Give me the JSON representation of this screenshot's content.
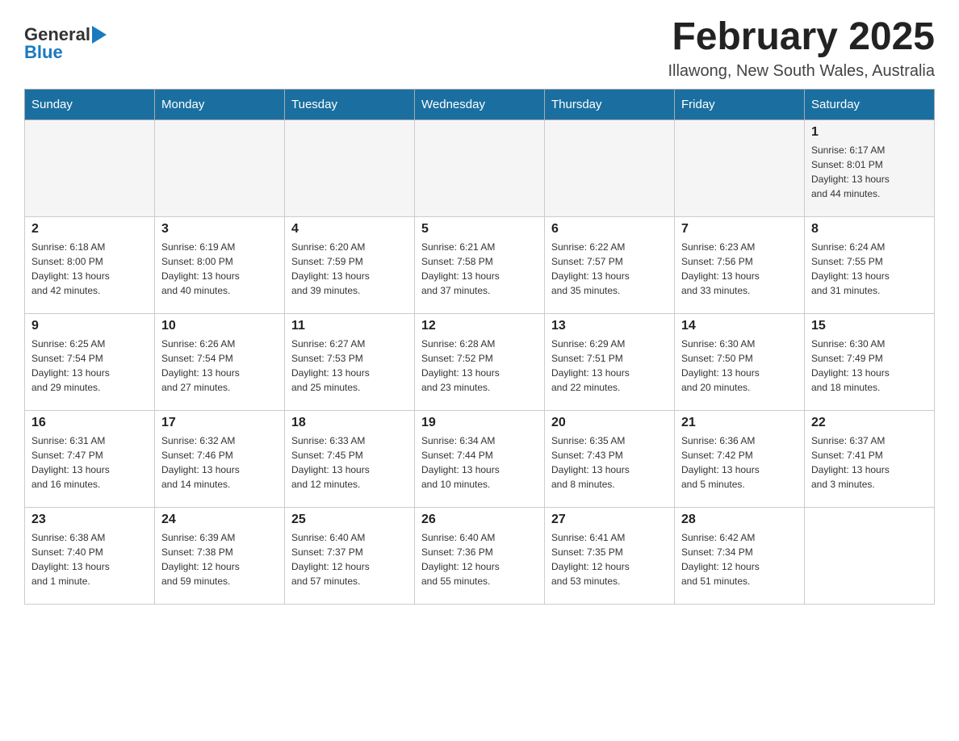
{
  "header": {
    "logo_general": "General",
    "logo_blue": "Blue",
    "month_title": "February 2025",
    "location": "Illawong, New South Wales, Australia"
  },
  "calendar": {
    "days_of_week": [
      "Sunday",
      "Monday",
      "Tuesday",
      "Wednesday",
      "Thursday",
      "Friday",
      "Saturday"
    ],
    "weeks": [
      [
        {
          "day": "",
          "info": ""
        },
        {
          "day": "",
          "info": ""
        },
        {
          "day": "",
          "info": ""
        },
        {
          "day": "",
          "info": ""
        },
        {
          "day": "",
          "info": ""
        },
        {
          "day": "",
          "info": ""
        },
        {
          "day": "1",
          "info": "Sunrise: 6:17 AM\nSunset: 8:01 PM\nDaylight: 13 hours\nand 44 minutes."
        }
      ],
      [
        {
          "day": "2",
          "info": "Sunrise: 6:18 AM\nSunset: 8:00 PM\nDaylight: 13 hours\nand 42 minutes."
        },
        {
          "day": "3",
          "info": "Sunrise: 6:19 AM\nSunset: 8:00 PM\nDaylight: 13 hours\nand 40 minutes."
        },
        {
          "day": "4",
          "info": "Sunrise: 6:20 AM\nSunset: 7:59 PM\nDaylight: 13 hours\nand 39 minutes."
        },
        {
          "day": "5",
          "info": "Sunrise: 6:21 AM\nSunset: 7:58 PM\nDaylight: 13 hours\nand 37 minutes."
        },
        {
          "day": "6",
          "info": "Sunrise: 6:22 AM\nSunset: 7:57 PM\nDaylight: 13 hours\nand 35 minutes."
        },
        {
          "day": "7",
          "info": "Sunrise: 6:23 AM\nSunset: 7:56 PM\nDaylight: 13 hours\nand 33 minutes."
        },
        {
          "day": "8",
          "info": "Sunrise: 6:24 AM\nSunset: 7:55 PM\nDaylight: 13 hours\nand 31 minutes."
        }
      ],
      [
        {
          "day": "9",
          "info": "Sunrise: 6:25 AM\nSunset: 7:54 PM\nDaylight: 13 hours\nand 29 minutes."
        },
        {
          "day": "10",
          "info": "Sunrise: 6:26 AM\nSunset: 7:54 PM\nDaylight: 13 hours\nand 27 minutes."
        },
        {
          "day": "11",
          "info": "Sunrise: 6:27 AM\nSunset: 7:53 PM\nDaylight: 13 hours\nand 25 minutes."
        },
        {
          "day": "12",
          "info": "Sunrise: 6:28 AM\nSunset: 7:52 PM\nDaylight: 13 hours\nand 23 minutes."
        },
        {
          "day": "13",
          "info": "Sunrise: 6:29 AM\nSunset: 7:51 PM\nDaylight: 13 hours\nand 22 minutes."
        },
        {
          "day": "14",
          "info": "Sunrise: 6:30 AM\nSunset: 7:50 PM\nDaylight: 13 hours\nand 20 minutes."
        },
        {
          "day": "15",
          "info": "Sunrise: 6:30 AM\nSunset: 7:49 PM\nDaylight: 13 hours\nand 18 minutes."
        }
      ],
      [
        {
          "day": "16",
          "info": "Sunrise: 6:31 AM\nSunset: 7:47 PM\nDaylight: 13 hours\nand 16 minutes."
        },
        {
          "day": "17",
          "info": "Sunrise: 6:32 AM\nSunset: 7:46 PM\nDaylight: 13 hours\nand 14 minutes."
        },
        {
          "day": "18",
          "info": "Sunrise: 6:33 AM\nSunset: 7:45 PM\nDaylight: 13 hours\nand 12 minutes."
        },
        {
          "day": "19",
          "info": "Sunrise: 6:34 AM\nSunset: 7:44 PM\nDaylight: 13 hours\nand 10 minutes."
        },
        {
          "day": "20",
          "info": "Sunrise: 6:35 AM\nSunset: 7:43 PM\nDaylight: 13 hours\nand 8 minutes."
        },
        {
          "day": "21",
          "info": "Sunrise: 6:36 AM\nSunset: 7:42 PM\nDaylight: 13 hours\nand 5 minutes."
        },
        {
          "day": "22",
          "info": "Sunrise: 6:37 AM\nSunset: 7:41 PM\nDaylight: 13 hours\nand 3 minutes."
        }
      ],
      [
        {
          "day": "23",
          "info": "Sunrise: 6:38 AM\nSunset: 7:40 PM\nDaylight: 13 hours\nand 1 minute."
        },
        {
          "day": "24",
          "info": "Sunrise: 6:39 AM\nSunset: 7:38 PM\nDaylight: 12 hours\nand 59 minutes."
        },
        {
          "day": "25",
          "info": "Sunrise: 6:40 AM\nSunset: 7:37 PM\nDaylight: 12 hours\nand 57 minutes."
        },
        {
          "day": "26",
          "info": "Sunrise: 6:40 AM\nSunset: 7:36 PM\nDaylight: 12 hours\nand 55 minutes."
        },
        {
          "day": "27",
          "info": "Sunrise: 6:41 AM\nSunset: 7:35 PM\nDaylight: 12 hours\nand 53 minutes."
        },
        {
          "day": "28",
          "info": "Sunrise: 6:42 AM\nSunset: 7:34 PM\nDaylight: 12 hours\nand 51 minutes."
        },
        {
          "day": "",
          "info": ""
        }
      ]
    ]
  }
}
